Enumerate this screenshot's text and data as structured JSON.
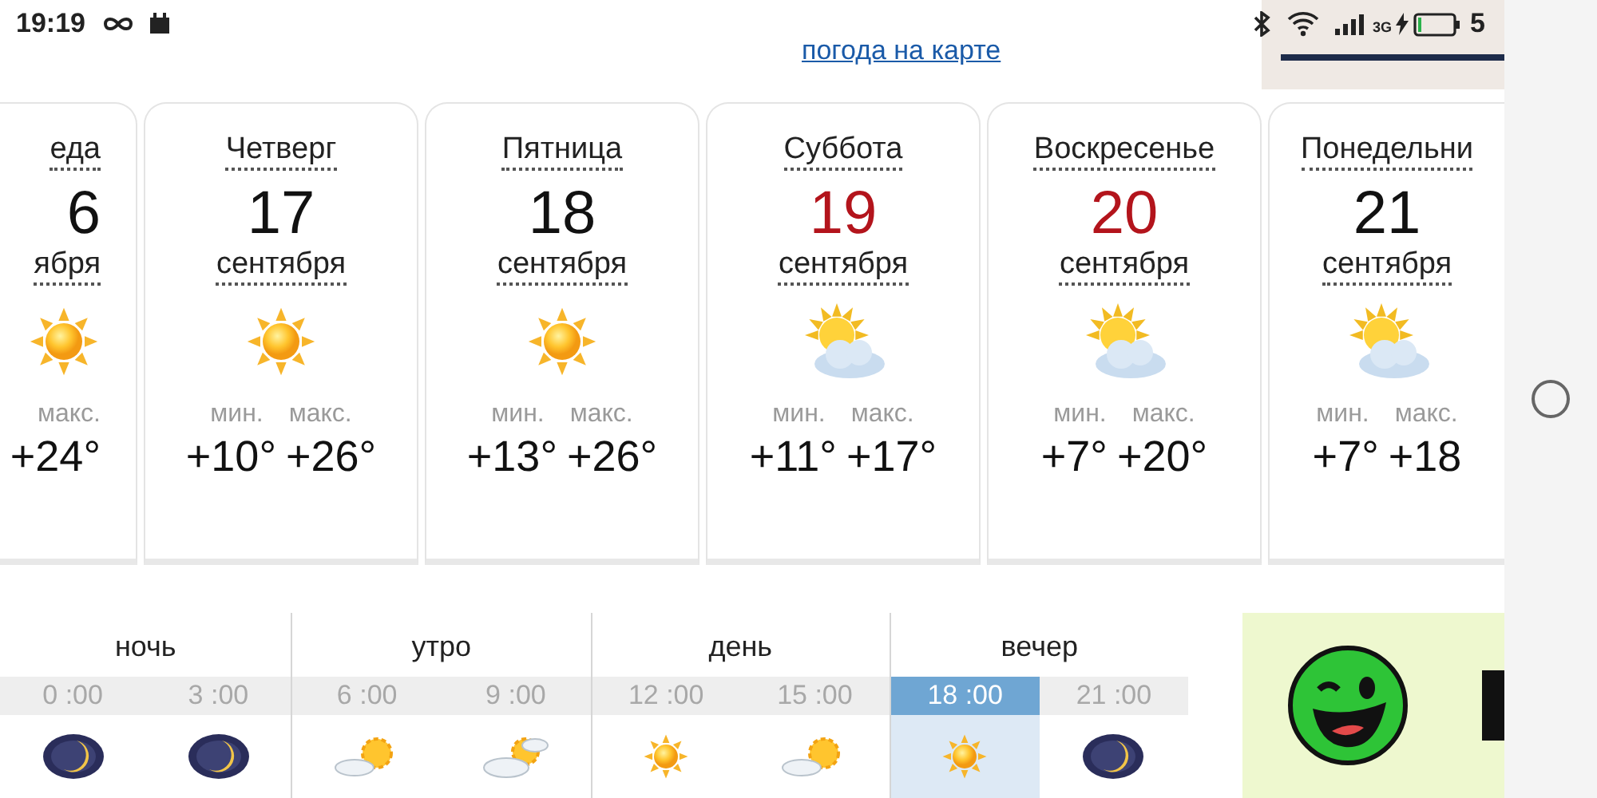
{
  "status_bar": {
    "time": "19:19",
    "network": "3G",
    "battery": "5"
  },
  "map_link": "погода на карте",
  "days": [
    {
      "kind": "cut_left",
      "weekday": "еда",
      "date": "6",
      "month": "ября",
      "weekend": false,
      "icon": {
        "kind": "sun"
      },
      "max_label": "макс.",
      "max": "+24°"
    },
    {
      "kind": "full",
      "weekday": "Четверг",
      "date": "17",
      "month": "сентября",
      "weekend": false,
      "icon": {
        "kind": "sun"
      },
      "min_label": "мин.",
      "min": "+10°",
      "max_label": "макс.",
      "max": "+26°"
    },
    {
      "kind": "full",
      "weekday": "Пятница",
      "date": "18",
      "month": "сентября",
      "weekend": false,
      "icon": {
        "kind": "sun"
      },
      "min_label": "мин.",
      "min": "+13°",
      "max_label": "макс.",
      "max": "+26°"
    },
    {
      "kind": "full",
      "weekday": "Суббота",
      "date": "19",
      "month": "сентября",
      "weekend": true,
      "icon": {
        "kind": "suncloud"
      },
      "min_label": "мин.",
      "min": "+11°",
      "max_label": "макс.",
      "max": "+17°"
    },
    {
      "kind": "full",
      "weekday": "Воскресенье",
      "date": "20",
      "month": "сентября",
      "weekend": true,
      "icon": {
        "kind": "suncloud"
      },
      "min_label": "мин.",
      "min": "+7°",
      "max_label": "макс.",
      "max": "+20°"
    },
    {
      "kind": "cut_right",
      "weekday": "Понедельни",
      "date": "21",
      "month": "сентября",
      "weekend": false,
      "icon": {
        "kind": "suncloud"
      },
      "min_label": "мин.",
      "min": "+7°",
      "max_label": "макс.",
      "max": "+18"
    }
  ],
  "periods": [
    {
      "label": "ночь",
      "slots": [
        {
          "time": "0 :00",
          "selected": false,
          "icon": {
            "kind": "moon"
          }
        },
        {
          "time": "3 :00",
          "selected": false,
          "icon": {
            "kind": "moon"
          }
        }
      ]
    },
    {
      "label": "утро",
      "slots": [
        {
          "time": "6 :00",
          "selected": false,
          "icon": {
            "kind": "suncloud"
          }
        },
        {
          "time": "9 :00",
          "selected": false,
          "icon": {
            "kind": "cloudsun"
          }
        }
      ]
    },
    {
      "label": "день",
      "slots": [
        {
          "time": "12 :00",
          "selected": false,
          "icon": {
            "kind": "sun"
          }
        },
        {
          "time": "15 :00",
          "selected": false,
          "icon": {
            "kind": "suncloud"
          }
        }
      ]
    },
    {
      "label": "вечер",
      "slots": [
        {
          "time": "18 :00",
          "selected": true,
          "icon": {
            "kind": "sun"
          }
        },
        {
          "time": "21 :00",
          "selected": false,
          "icon": {
            "kind": "moon"
          }
        }
      ]
    }
  ]
}
